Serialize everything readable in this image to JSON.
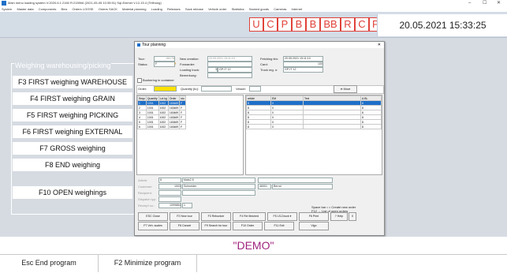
{
  "window": {
    "title": "Main menu loading system V:2020.6.1.2160 R:2159h6 (2021-05-05 10:35:51) Sql-Enimet V.12-15.4 (Tellhong)",
    "controls": [
      "–",
      "☐",
      "✕"
    ]
  },
  "menu": [
    "System",
    "Master data",
    "Components",
    "Bins",
    "Orders LOOSE",
    "Orders SACK",
    "Material planning",
    "Loading",
    "Releases",
    "Sack release",
    "Vehicle order",
    "Statistics",
    "Sacked goods",
    "Cameras",
    "Internet"
  ],
  "letters": [
    "U",
    "C",
    "P",
    "B",
    "B",
    "BB",
    "R",
    "C",
    "PL"
  ],
  "datetime": "20.05.2021 15:33:25",
  "left_panel": {
    "title": "Weighing warehousing/picking",
    "buttons": [
      "F3 FIRST weighing WAREHOUSE",
      "F4 FIRST weighing GRAIN",
      "F5 FIRST weighing PICKING",
      "F6 FIRST weighing EXTERNAL",
      "F7 GROSS weighing",
      "F8 END weighing",
      "F10 OPEN weighings"
    ]
  },
  "dialog": {
    "title": "Tour planning",
    "close": "✕",
    "fields": {
      "tour_label": "Tour:",
      "tour_value": "66175",
      "status_label": "Status:",
      "status_value": "F",
      "new_creation_label": "New creation:",
      "new_creation_value": "20.05.2021 15:11:10",
      "forwarder_label": "Forwarder:",
      "loading_truck_label": "Loading truck:",
      "loading_truck_num": "3",
      "loading_truck_value": "GP-IT 12",
      "remark_label": "Bemerkung:",
      "fetching_label": "Fetching tim:",
      "fetching_value": "20.05.2021 15:11:10",
      "card_label": "Card:",
      "card_value": "100",
      "truck_reg_label": "Truck reg. n:",
      "truck_reg_value": "GP-IT 12",
      "bunkering_label": "Bunkering in container",
      "order_label": "Order:",
      "quantity_label": "Quantity [to]:",
      "vessel_label": "Vessel:",
      "move_label": "Move"
    },
    "left_table": {
      "headers": [
        "Sequ",
        "Quantity",
        "Lot kg",
        "Order",
        "stu"
      ],
      "rows": [
        [
          "1",
          "1001",
          "1002",
          "163469",
          "F"
        ],
        [
          "2",
          "1001",
          "1002",
          "163469",
          "F"
        ],
        [
          "3",
          "1001",
          "1002",
          "163469",
          "F"
        ],
        [
          "4",
          "1001",
          "1002",
          "163469",
          "F"
        ],
        [
          "5",
          "1001",
          "1002",
          "163469",
          "F"
        ],
        [
          "6",
          "1001",
          "1002",
          "163469",
          "F"
        ]
      ]
    },
    "right_table": {
      "headers": [
        "article",
        "EM",
        "Text",
        "A.BL"
      ],
      "rows": [
        [
          "8",
          "0",
          "",
          "8"
        ],
        [
          "8",
          "0",
          "",
          "8"
        ],
        [
          "8",
          "0",
          "",
          "8"
        ],
        [
          "8",
          "0",
          "",
          "8"
        ],
        [
          "8",
          "0",
          "",
          "8"
        ],
        [
          "8",
          "0",
          "",
          "8"
        ]
      ]
    },
    "detail": {
      "article_label": "Article:",
      "article_num": "8",
      "article_text": "Mais2 8",
      "customer_label": "Customer:",
      "customer_num": "1003",
      "customer_text": "Schneider",
      "customer_zip": "46001",
      "customer_city": "Bernd",
      "recipient_label": "Recipient:",
      "dispatch_label": "Dispatch typ:",
      "receipt_label": "Receipt no.:",
      "receipt_value": "1099884",
      "receipt_extra": "1"
    },
    "hint1": "Space bar • = Create new order",
    "hint2": "F12 → List of open orders",
    "buttons_row1": [
      "ESC Close",
      "F2 New tour",
      "F3 Rebunker",
      "F4 Rel finished",
      "F5 LS-Druck ▾",
      "F6 Print",
      "? Help",
      "X"
    ],
    "buttons_row2": [
      "F7 Veh. scales",
      "F8 Cancel",
      "F9 Search for tour",
      "F10 Order",
      "F11 Exit",
      "Vigo"
    ]
  },
  "demo": "\"DEMO\"",
  "bottom": [
    "Esc End program",
    "F2 Minimize program"
  ]
}
